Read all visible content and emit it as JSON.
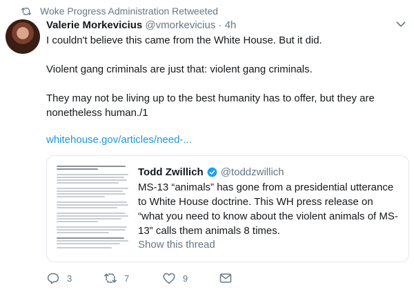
{
  "retweet_banner": {
    "text": "Woke Progress Administration Retweeted"
  },
  "tweet": {
    "author_name": "Valerie Morkevicius",
    "author_handle": "@vmorkevicius",
    "separator": "·",
    "time": "4h",
    "paragraphs": [
      "I couldn't believe this came from the White House. But it did.",
      "Violent gang criminals are just that: violent gang criminals.",
      "They may not be living up to the best humanity has to offer, but they are nonetheless human./1"
    ],
    "link": "whitehouse.gov/articles/need-..."
  },
  "quoted": {
    "author_name": "Todd Zwillich",
    "author_handle": "@toddzwillich",
    "text": "MS-13 “animals” has gone from a presidential utterance to White House doctrine. This WH press release on “what you need to know about the violent animals of MS-13” calls them animals 8 times.",
    "show_thread": "Show this thread"
  },
  "actions": {
    "reply_count": "3",
    "retweet_count": "7",
    "like_count": "9"
  },
  "icons": [
    "retweet-icon",
    "chevron-down-icon",
    "verified-icon",
    "reply-icon",
    "retweet-icon",
    "like-icon",
    "message-icon"
  ],
  "colors": {
    "link": "#1b95e0",
    "muted": "#657786",
    "verified": "#1da1f2",
    "text": "#14171a"
  }
}
